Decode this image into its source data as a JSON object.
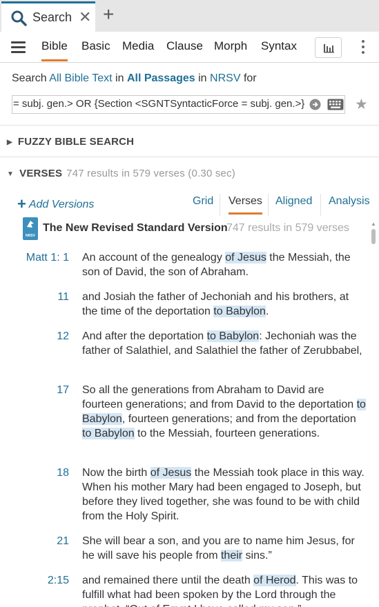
{
  "tab": {
    "label": "Search",
    "close": "✕",
    "add": "+"
  },
  "toolbar": {
    "modes": [
      "Bible",
      "Basic",
      "Media",
      "Clause",
      "Morph",
      "Syntax"
    ],
    "active_mode": "Bible"
  },
  "search_line": {
    "prefix": "Search",
    "scope": "All Bible Text",
    "in1": "in",
    "passages": "All Passages",
    "in2": "in",
    "version": "NRSV",
    "for": "for"
  },
  "query": "= subj. gen.> OR {Section <SGNTSyntacticForce = subj. gen.>}",
  "sections": {
    "fuzzy": {
      "arrow": "▶",
      "label": "FUZZY BIBLE SEARCH"
    },
    "verses": {
      "arrow": "▼",
      "label": "VERSES",
      "meta": "747 results in 579 verses (0.30 sec)"
    }
  },
  "add_versions": {
    "plus": "+",
    "label": "Add Versions"
  },
  "view_tabs": [
    "Grid",
    "Verses",
    "Aligned",
    "Analysis"
  ],
  "active_view": "Verses",
  "version": {
    "badge": "NRSV",
    "title": "The New Revised Standard Version",
    "meta": "747 results in 579 verses"
  },
  "verses": [
    {
      "ref": "Matt 1:  1",
      "parts": [
        {
          "t": "An account of the genealogy "
        },
        {
          "t": "of Jesus",
          "hl": true
        },
        {
          "t": " the Messiah, the son of David, the son of Abraham."
        }
      ]
    },
    {
      "ref": "11",
      "parts": [
        {
          "t": "and Josiah the father of Jechoniah and his brothers, at the time of the deportation "
        },
        {
          "t": "to Babylon",
          "hl": true
        },
        {
          "t": "."
        }
      ]
    },
    {
      "ref": "12",
      "parts": [
        {
          "t": "And after the deportation "
        },
        {
          "t": "to Babylon",
          "hl": true
        },
        {
          "t": ": Jechoniah was the father of Salathiel, and Salathiel the father of Zerubbabel,"
        }
      ]
    },
    {
      "ref": "17",
      "parts": [
        {
          "t": "So all the generations from Abraham to David are fourteen generations; and from David to the deportation "
        },
        {
          "t": "to Babylon",
          "hl": true
        },
        {
          "t": ", fourteen generations; and from the deportation "
        },
        {
          "t": "to Babylon",
          "hl": true
        },
        {
          "t": " to the Messiah, fourteen generations."
        }
      ]
    },
    {
      "ref": "18",
      "parts": [
        {
          "t": "Now the birth "
        },
        {
          "t": "of Jesus",
          "hl": true
        },
        {
          "t": " the Messiah took place in this way. When his mother Mary had been engaged to Joseph, but before they lived together, she was found to be with child from the Holy Spirit."
        }
      ]
    },
    {
      "ref": "21",
      "parts": [
        {
          "t": "She will bear a son, and you are to name him Jesus, for he will save his people from "
        },
        {
          "t": "their",
          "hl": true
        },
        {
          "t": " sins.”"
        }
      ]
    },
    {
      "ref": "2:15",
      "parts": [
        {
          "t": "and remained there until the death "
        },
        {
          "t": "of Herod",
          "hl": true
        },
        {
          "t": ". This was to fulfill what had been spoken by the Lord through the prophet, “Out of Egypt I have called my son.”"
        }
      ]
    }
  ],
  "colors": {
    "accent": "#1f6f96",
    "active_underline": "#e07a2e",
    "highlight": "#d4e6f4"
  }
}
